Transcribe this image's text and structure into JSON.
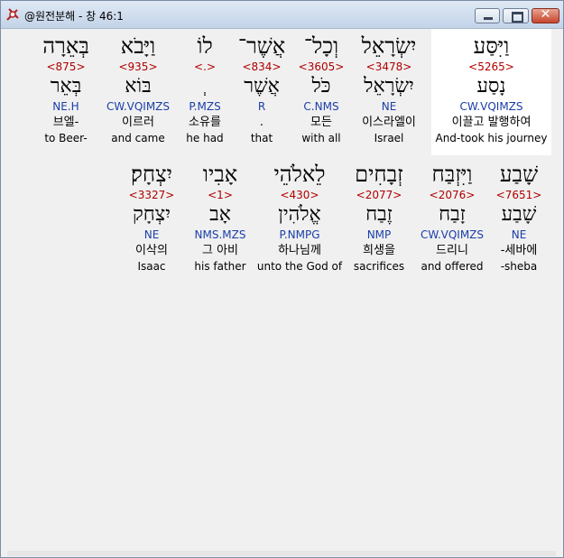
{
  "window": {
    "title": "@원전분해 - 창 46:1"
  },
  "row1": [
    {
      "heb": "וַיִּסַּע",
      "strong": "<5265>",
      "lemma": "נָסַע",
      "morph": "CW.VQIMZS",
      "korean": "이끌고 발행하여",
      "english": "And-took his journey",
      "selected": true
    },
    {
      "heb": "יִשְׂרָאֵל",
      "strong": "<3478>",
      "lemma": "יִשְׂרָאֵל",
      "morph": "NE",
      "korean": "이스라엘이",
      "english": "Israel"
    },
    {
      "heb": "וְכָל־",
      "strong": "<3605>",
      "lemma": "כֹּל",
      "morph": "C.NMS",
      "korean": "모든",
      "english": "with all"
    },
    {
      "heb": "אֲשֶׁר־",
      "strong": "<834>",
      "lemma": "אֲשֶׁר",
      "morph": "R",
      "korean": ".",
      "english": "that"
    },
    {
      "heb": "לוֹ",
      "strong": "<.>",
      "lemma": "ְ",
      "morph": "P.MZS",
      "korean": "소유를",
      "english": "he had"
    },
    {
      "heb": "וַיָּבֹא",
      "strong": "<935>",
      "lemma": "בּוֹא",
      "morph": "CW.VQIMZS",
      "korean": "이르러",
      "english": "and came"
    },
    {
      "heb": "בְּאֵרָה",
      "strong": "<875>",
      "lemma": "בְּאֵר",
      "morph": "NE.H",
      "korean": "브엘-",
      "english": "to Beer-"
    }
  ],
  "row2": [
    {
      "heb": "שָׁבַע",
      "strong": "<7651>",
      "lemma": "שָׁבַע",
      "morph": "NE",
      "korean": "-세바에",
      "english": "-sheba"
    },
    {
      "heb": "וַיִּזְבַּח",
      "strong": "<2076>",
      "lemma": "זָבַח",
      "morph": "CW.VQIMZS",
      "korean": "드리니",
      "english": "and offered"
    },
    {
      "heb": "זְבָחִים",
      "strong": "<2077>",
      "lemma": "זֶבַח",
      "morph": "NMP",
      "korean": "희생을",
      "english": "sacrifices"
    },
    {
      "heb": "לֵאלֹהֵי",
      "strong": "<430>",
      "lemma": "אֱלֹהִין",
      "morph": "P.NMPG",
      "korean": "하나님께",
      "english": "unto the God of"
    },
    {
      "heb": "אָבִיו",
      "strong": "<1>",
      "lemma": "אָב",
      "morph": "NMS.MZS",
      "korean": "그 아비",
      "english": "his father"
    },
    {
      "heb": "יִצְחָק׃",
      "strong": "<3327>",
      "lemma": "יִצְחָק",
      "morph": "NE",
      "korean": "이삭의",
      "english": "Isaac"
    }
  ]
}
